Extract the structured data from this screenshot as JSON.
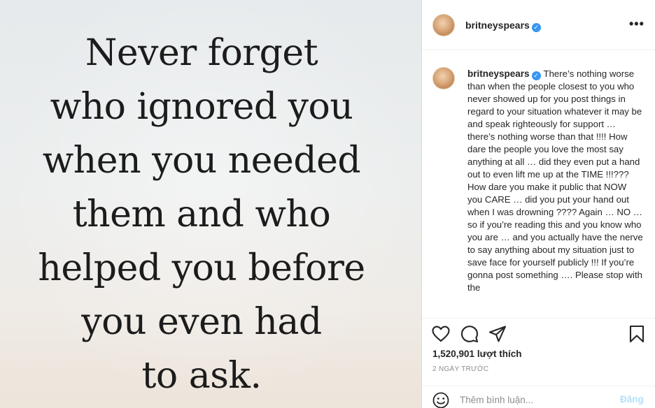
{
  "post": {
    "image_quote_lines": [
      "Never forget",
      "who ignored you",
      "when you needed",
      "them and who",
      "helped you before",
      "you even had",
      "to ask."
    ]
  },
  "header": {
    "username": "britneyspears",
    "verified_icon": "verified-badge-icon",
    "more_label": "•••"
  },
  "caption": {
    "username": "britneyspears",
    "text": "There’s nothing worse than when the people closest to you who never showed up for you post things in regard to your situation whatever it may be and speak righteously for support … there’s nothing worse than that !!!! How dare the people you love the most say anything at all … did they even put a hand out to even lift me up at the TIME !!!??? How dare you make it public that NOW you CARE … did you put your hand out when I was drowning ???? Again … NO … so if you’re reading this and you know who you are … and you actually have the nerve to say anything about my situation just to save face for yourself publicly !!! If you’re gonna post something …. Please stop with the"
  },
  "actions": {
    "icons": [
      "heart-icon",
      "comment-icon",
      "share-icon",
      "bookmark-icon"
    ],
    "likes_count": "1,520,901",
    "likes_unit": "lượt thích",
    "timestamp": "2 NGÀY TRƯỚC"
  },
  "comment": {
    "placeholder": "Thêm bình luận...",
    "post_label": "Đăng"
  },
  "colors": {
    "verified": "#3897f0",
    "post_disabled": "#b2dffc",
    "muted": "#8e8e8e",
    "text": "#262626"
  }
}
